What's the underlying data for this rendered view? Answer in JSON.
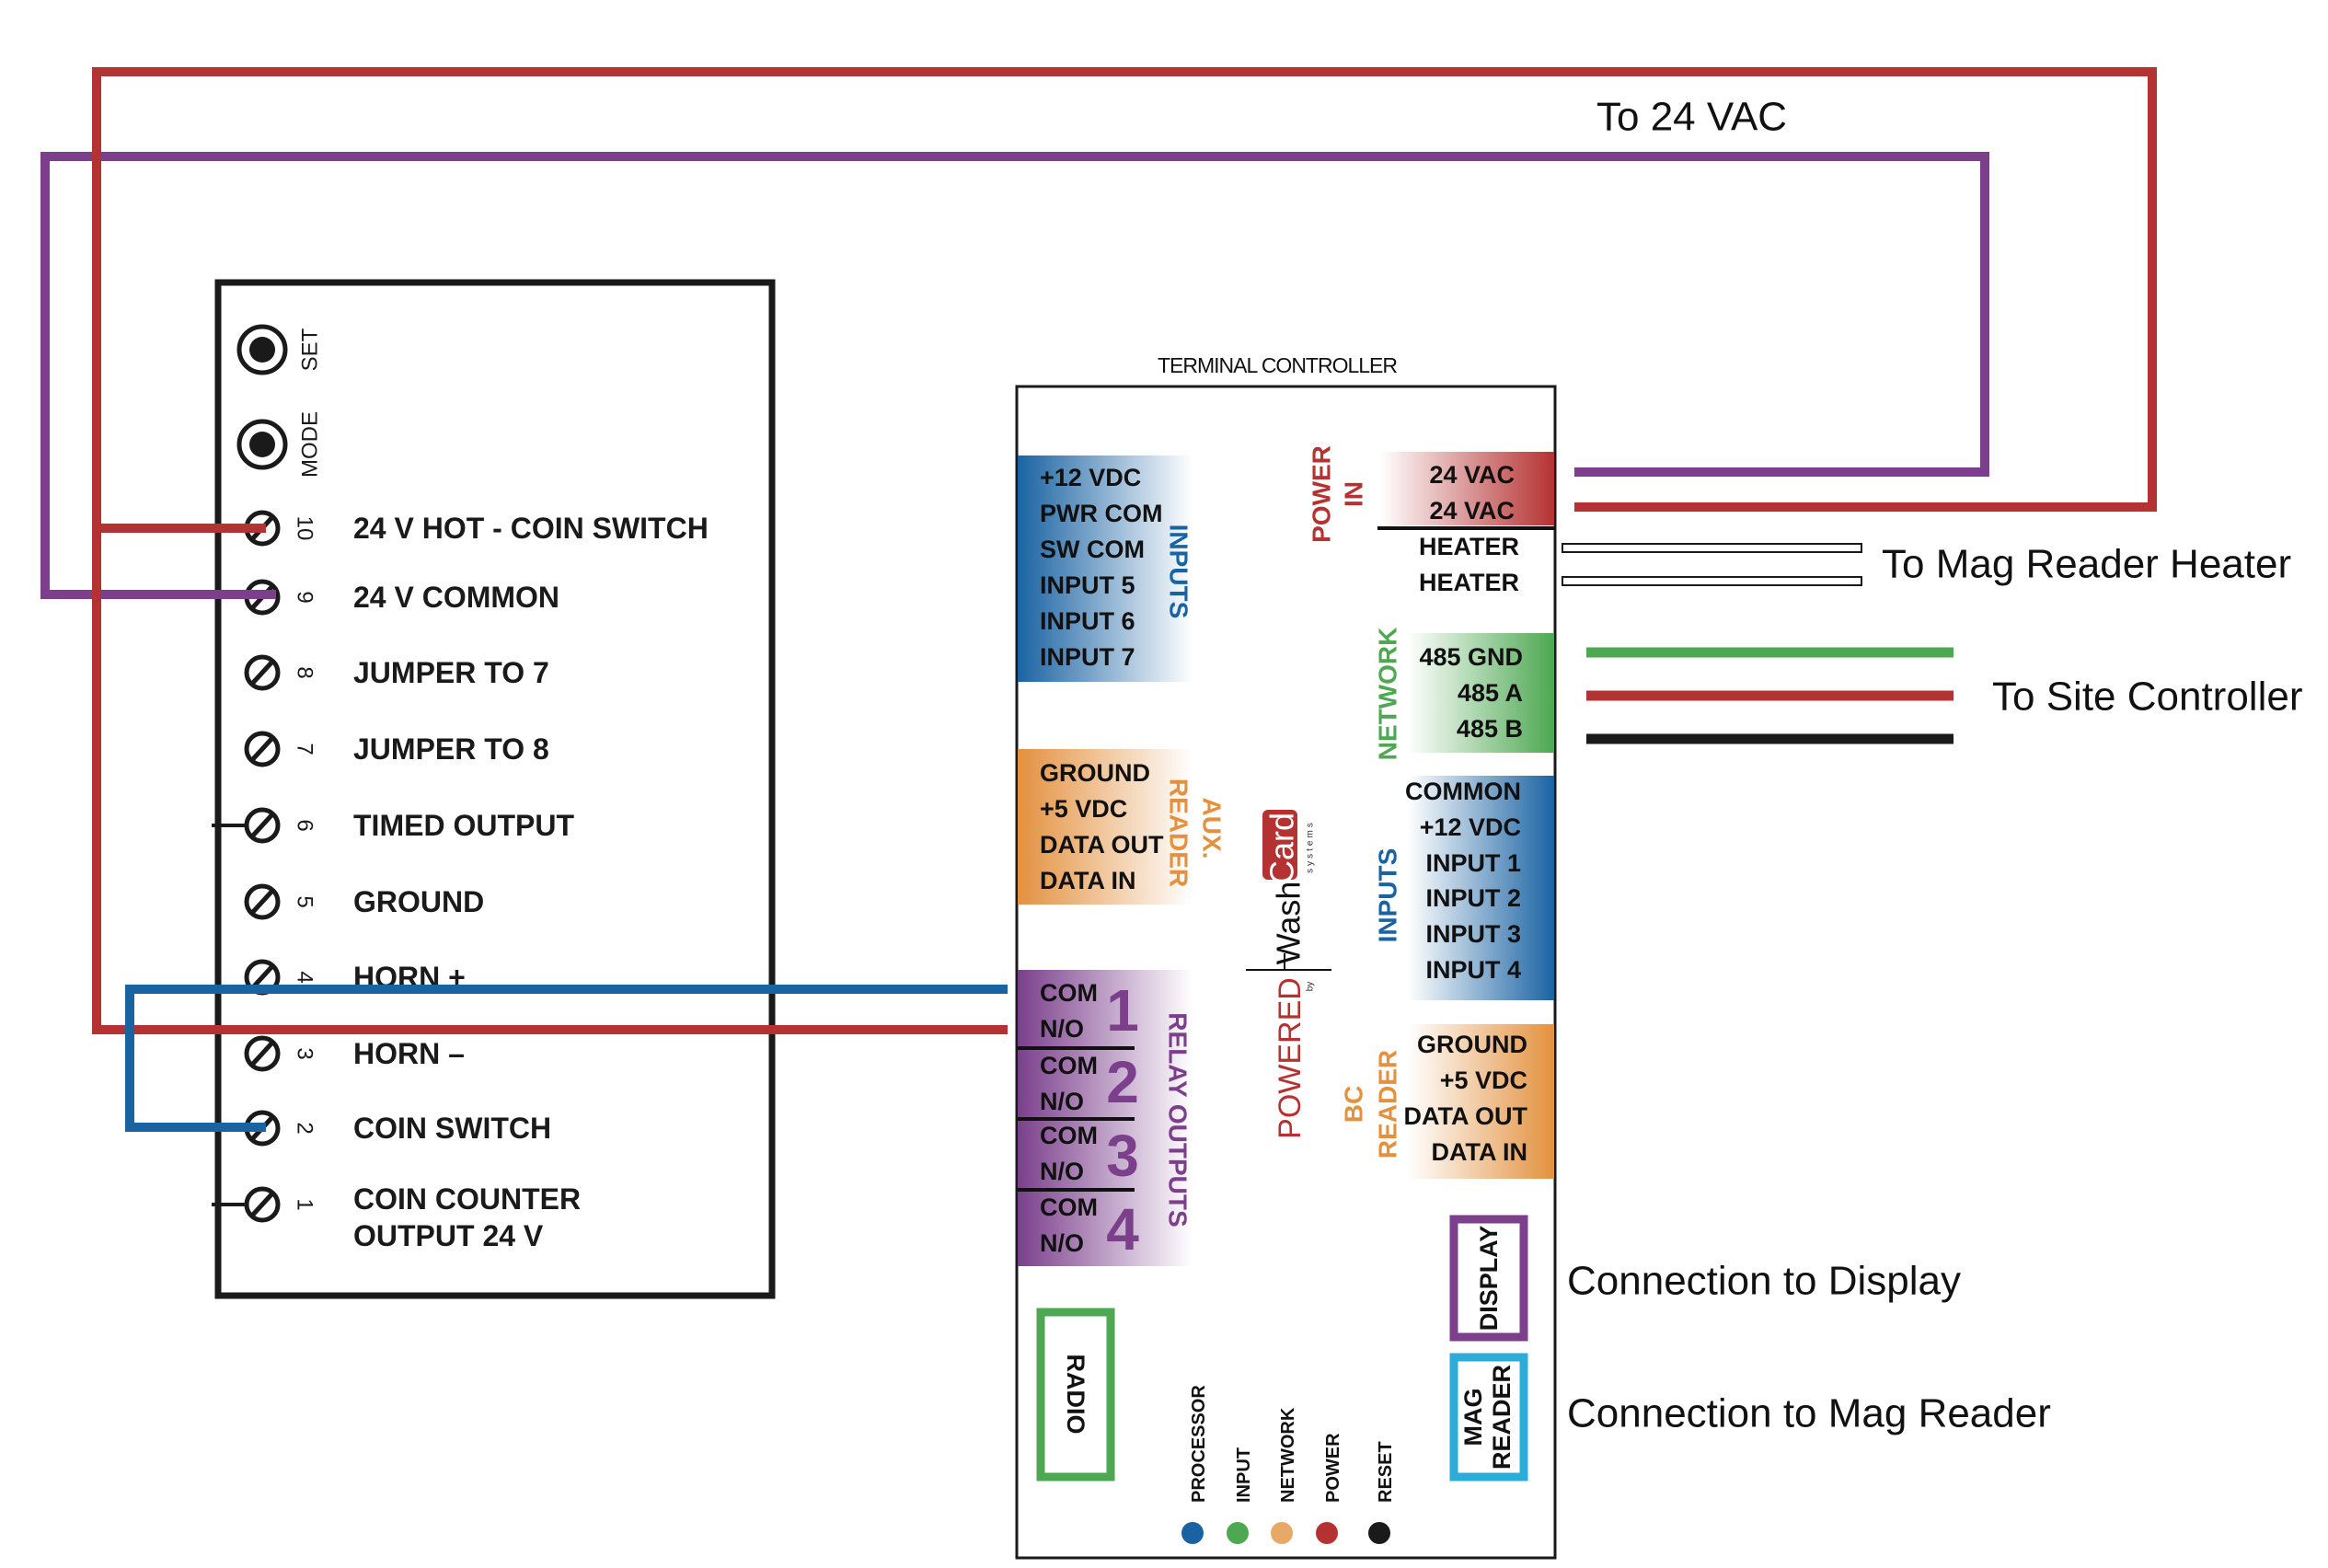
{
  "colors": {
    "red": "#B53232",
    "purple": "#7B3F8C",
    "blue": "#1A63A3",
    "green": "#4DA851",
    "orange": "#E3913F",
    "cyan": "#2BACD9",
    "black": "#1a1a1a"
  },
  "annotations": {
    "to_24vac": "To 24 VAC",
    "to_mag_heater": "To Mag Reader Heater",
    "to_site_controller": "To Site Controller",
    "connection_display": "Connection to Display",
    "connection_mag_reader": "Connection to Mag Reader"
  },
  "coin_acceptor": {
    "buttons": [
      "SET",
      "MODE"
    ],
    "terminals": [
      {
        "num": "10",
        "label": "24 V HOT - COIN SWITCH"
      },
      {
        "num": "9",
        "label": "24 V COMMON"
      },
      {
        "num": "8",
        "label": "JUMPER TO 7"
      },
      {
        "num": "7",
        "label": "JUMPER TO 8"
      },
      {
        "num": "6",
        "label": "TIMED OUTPUT"
      },
      {
        "num": "5",
        "label": "GROUND"
      },
      {
        "num": "4",
        "label": "HORN +"
      },
      {
        "num": "3",
        "label": "HORN –"
      },
      {
        "num": "2",
        "label": "COIN SWITCH"
      },
      {
        "num": "1",
        "label": "COIN COUNTER",
        "label_2": "OUTPUT 24 V"
      }
    ]
  },
  "controller": {
    "title": "TERMINAL CONTROLLER",
    "left_inputs": {
      "label": "INPUTS",
      "pins": [
        "+12 VDC",
        "PWR COM",
        "SW COM",
        "INPUT 5",
        "INPUT 6",
        "INPUT 7"
      ]
    },
    "aux_reader": {
      "label_1": "AUX.",
      "label_2": "READER",
      "pins": [
        "GROUND",
        "+5 VDC",
        "DATA OUT",
        "DATA IN"
      ]
    },
    "relay_outputs": {
      "label": "RELAY OUTPUTS",
      "relays": [
        {
          "num": "1",
          "com": "COM",
          "no": "N/O"
        },
        {
          "num": "2",
          "com": "COM",
          "no": "N/O"
        },
        {
          "num": "3",
          "com": "COM",
          "no": "N/O"
        },
        {
          "num": "4",
          "com": "COM",
          "no": "N/O"
        }
      ]
    },
    "power_in": {
      "label_1": "POWER",
      "label_2": "IN",
      "pins": [
        "24 VAC",
        "24 VAC"
      ],
      "heater": [
        "HEATER",
        "HEATER"
      ]
    },
    "network": {
      "label": "NETWORK",
      "pins": [
        "485 GND",
        "485 A",
        "485 B"
      ]
    },
    "right_inputs": {
      "label": "INPUTS",
      "pins": [
        "COMMON",
        "+12 VDC",
        "INPUT 1",
        "INPUT 2",
        "INPUT 3",
        "INPUT 4"
      ]
    },
    "bc_reader": {
      "label_1": "BC",
      "label_2": "READER",
      "pins": [
        "GROUND",
        "+5 VDC",
        "DATA OUT",
        "DATA IN"
      ]
    },
    "ports": {
      "display": "DISPLAY",
      "mag_reader_1": "MAG",
      "mag_reader_2": "READER",
      "radio": "RADIO"
    },
    "leds": [
      {
        "label": "PROCESSOR",
        "color": "#1A63A3"
      },
      {
        "label": "INPUT",
        "color": "#4DA851"
      },
      {
        "label": "NETWORK",
        "color": "#E8A866"
      },
      {
        "label": "POWER",
        "color": "#B53232"
      },
      {
        "label": "RESET",
        "color": "#1a1a1a"
      }
    ],
    "logo": {
      "wash": "Wash",
      "card": "Card",
      "systems": "systems",
      "powered": "POWERED",
      "by": "by"
    }
  }
}
